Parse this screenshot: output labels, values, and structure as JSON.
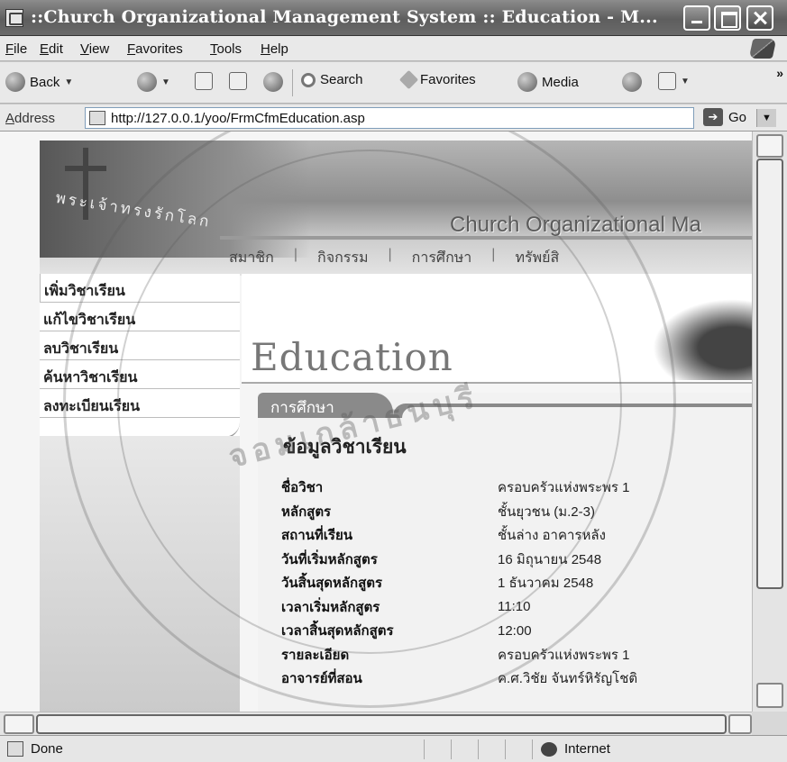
{
  "window": {
    "title": "::Church Organizational Management System :: Education - M...",
    "buttons": [
      "minimize",
      "maximize",
      "close"
    ]
  },
  "menu": [
    "File",
    "Edit",
    "View",
    "Favorites",
    "Tools",
    "Help"
  ],
  "toolbar": {
    "back": "Back",
    "search": "Search",
    "favorites": "Favorites",
    "media": "Media"
  },
  "address": {
    "label": "Address",
    "url": "http://127.0.0.1/yoo/FrmCfmEducation.asp",
    "go": "Go"
  },
  "banner": {
    "thai_subtitle": "พระเจ้าทรงรักโลก",
    "brand": "Church Organizational Ma"
  },
  "topnav": [
    "สมาชิก",
    "กิจกรรม",
    "การศึกษา",
    "ทรัพย์สิ"
  ],
  "sidenav": [
    "เพิ่มวิชาเรียน",
    "แก้ไขวิชาเรียน",
    "ลบวิชาเรียน",
    "ค้นหาวิชาเรียน",
    "ลงทะเบียนเรียน"
  ],
  "header": {
    "title": "Education"
  },
  "panel": {
    "tab": "การศึกษา",
    "heading": "ข้อมูลวิชาเรียน",
    "rows": [
      {
        "label": "ชื่อวิชา",
        "value": "ครอบครัวแห่งพระพร 1"
      },
      {
        "label": "หลักสูตร",
        "value": "ชั้นยุวชน (ม.2-3)"
      },
      {
        "label": "สถานที่เรียน",
        "value": "ชั้นล่าง อาคารหลัง"
      },
      {
        "label": "วันที่เริ่มหลักสูตร",
        "value": "16 มิถุนายน 2548"
      },
      {
        "label": "วันสิ้นสุดหลักสูตร",
        "value": "1 ธันวาคม 2548"
      },
      {
        "label": "เวลาเริ่มหลักสูตร",
        "value": "11:10"
      },
      {
        "label": "เวลาสิ้นสุดหลักสูตร",
        "value": "12:00"
      },
      {
        "label": "รายละเอียด",
        "value": "ครอบครัวแห่งพระพร 1"
      },
      {
        "label": "อาจารย์ที่สอน",
        "value": "ค.ศ.วิชัย จันทร์หิรัญโชติ"
      }
    ]
  },
  "status": {
    "text": "Done",
    "zone": "Internet"
  },
  "watermark": {
    "text": "จอมเกล้าธนบุรี"
  }
}
